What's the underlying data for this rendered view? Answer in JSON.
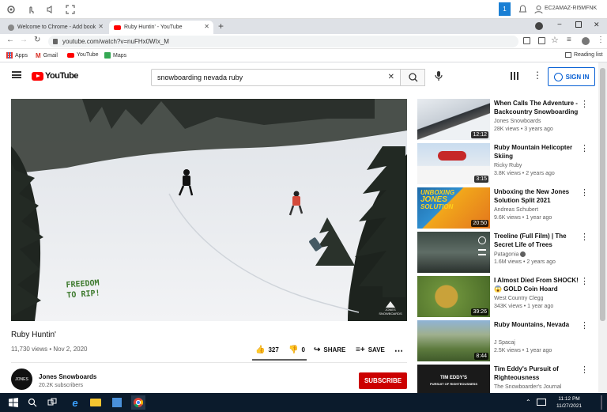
{
  "rdp_bar": {
    "counter": "1",
    "hostname": "EC2AMAZ-RI5MFNK"
  },
  "browser": {
    "tabs": [
      {
        "title": "Welcome to Chrome - Add book",
        "close": "✕"
      },
      {
        "title": "Ruby Huntin' - YouTube",
        "close": "✕"
      }
    ],
    "new_tab": "+",
    "url": "youtube.com/watch?v=nuFHx0WIx_M",
    "bookmarks": [
      {
        "label": "Apps"
      },
      {
        "label": "Gmail"
      },
      {
        "label": "YouTube"
      },
      {
        "label": "Maps"
      }
    ],
    "reading_list": "Reading list"
  },
  "youtube": {
    "logo_text": "YouTube",
    "search_value": "snowboarding nevada ruby",
    "sign_in": "SIGN IN",
    "video": {
      "title": "Ruby Huntin'",
      "meta": "11,730 views • Nov 2, 2020",
      "likes": "327",
      "dislikes": "0",
      "share": "SHARE",
      "save": "SAVE",
      "like_ratio": 1.0,
      "overlay_line1": "FREEDOM",
      "overlay_line2": "TO RIP!",
      "watermark": "JONES SNOWBOARDS"
    },
    "channel": {
      "name": "Jones Snowboards",
      "subs": "20.2K subscribers",
      "avatar_text": "JONES"
    },
    "subscribe": "SUBSCRIBE",
    "recommendations": [
      {
        "title": "When Calls The Adventure - Backcountry Snowboarding In...",
        "channel": "Jones Snowboards",
        "views": "28K views • 3 years ago",
        "duration": "12:12"
      },
      {
        "title": "Ruby Mountain Helicopter Skiing",
        "channel": "Ricky Ruby",
        "views": "3.8K views • 2 years ago",
        "duration": "3:15"
      },
      {
        "title": "Unboxing the New Jones Solution Split 2021",
        "channel": "Andreas Schubert",
        "views": "9.6K views • 1 year ago",
        "duration": "20:50",
        "thumb_text1": "UNBOXING",
        "thumb_text2": "JONES",
        "thumb_text3": "SOLUTION"
      },
      {
        "title": "Treeline (Full Film) | The Secret Life of Trees",
        "channel": "Patagonia",
        "views": "1.6M views • 2 years ago",
        "duration": ""
      },
      {
        "title": "I Almost Died From SHOCK! 😱 GOLD Coin Hoard",
        "channel": "West Country Clegg",
        "views": "343K views • 1 year ago",
        "duration": "39:26"
      },
      {
        "title": "Ruby Mountains, Nevada",
        "channel": "J Spacaj",
        "views": "2.5K views • 1 year ago",
        "duration": "8:44"
      },
      {
        "title": "Tim Eddy's Pursuit of Righteousness",
        "channel": "The Snowboarder's Journal",
        "views": "",
        "duration": "",
        "thumb_text1": "TIM EDDY'S",
        "thumb_text2": "PURSUIT OF RIGHTEOUSNESS"
      }
    ]
  },
  "taskbar": {
    "time": "11:12 PM",
    "date": "11/27/2021"
  },
  "colors": {
    "youtube_red": "#ff0000",
    "accent_blue": "#065fd4",
    "subscribe_red": "#cc0000",
    "taskbar": "#0b1b2c"
  }
}
